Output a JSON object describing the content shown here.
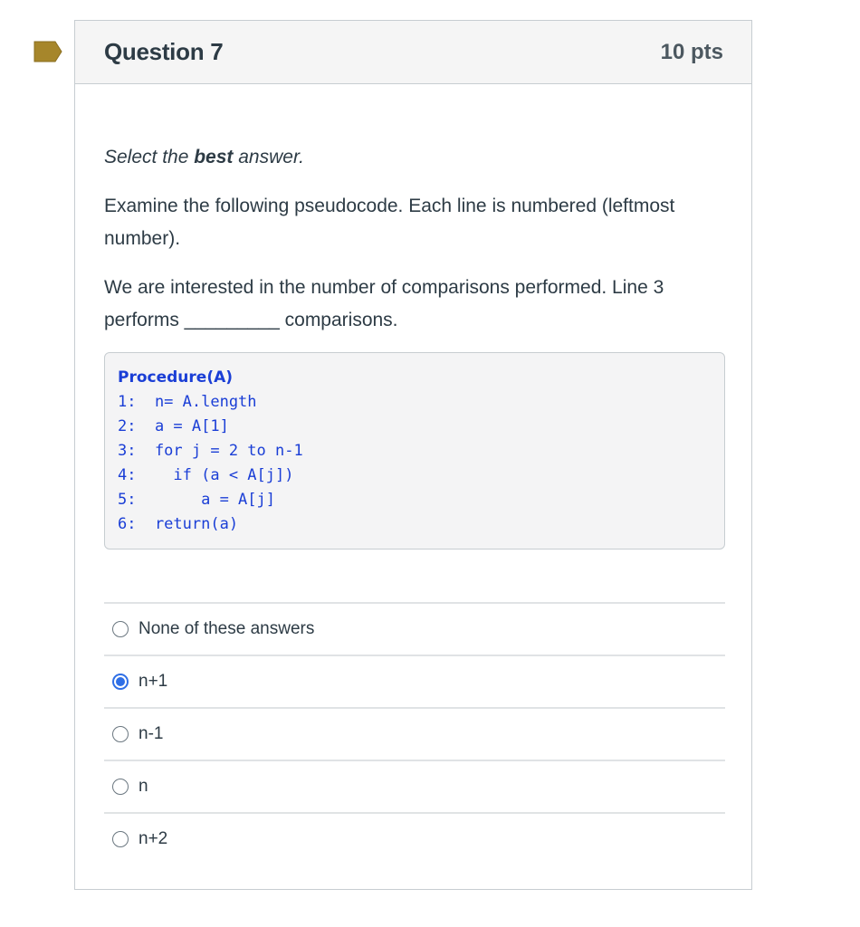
{
  "question": {
    "title": "Question 7",
    "points": "10 pts",
    "flag_color": "#a6862b",
    "instruction": {
      "prefix": "Select the ",
      "bold": "best",
      "suffix": " answer."
    },
    "paragraph1": "Examine the following pseudocode. Each line is numbered (leftmost number).",
    "paragraph2": "We are interested in the number of comparisons performed. Line 3 performs _________ comparisons.",
    "code": {
      "header": "Procedure(A)",
      "lines": [
        "1:  n= A.length",
        "2:  a = A[1]",
        "3:  for j = 2 to n-1",
        "4:    if (a < A[j])",
        "5:       a = A[j]",
        "6:  return(a)"
      ]
    },
    "answers": [
      {
        "label": "None of these answers",
        "selected": false
      },
      {
        "label": "n+1",
        "selected": true
      },
      {
        "label": "n-1",
        "selected": false
      },
      {
        "label": "n",
        "selected": false
      },
      {
        "label": "n+2",
        "selected": false
      }
    ]
  }
}
